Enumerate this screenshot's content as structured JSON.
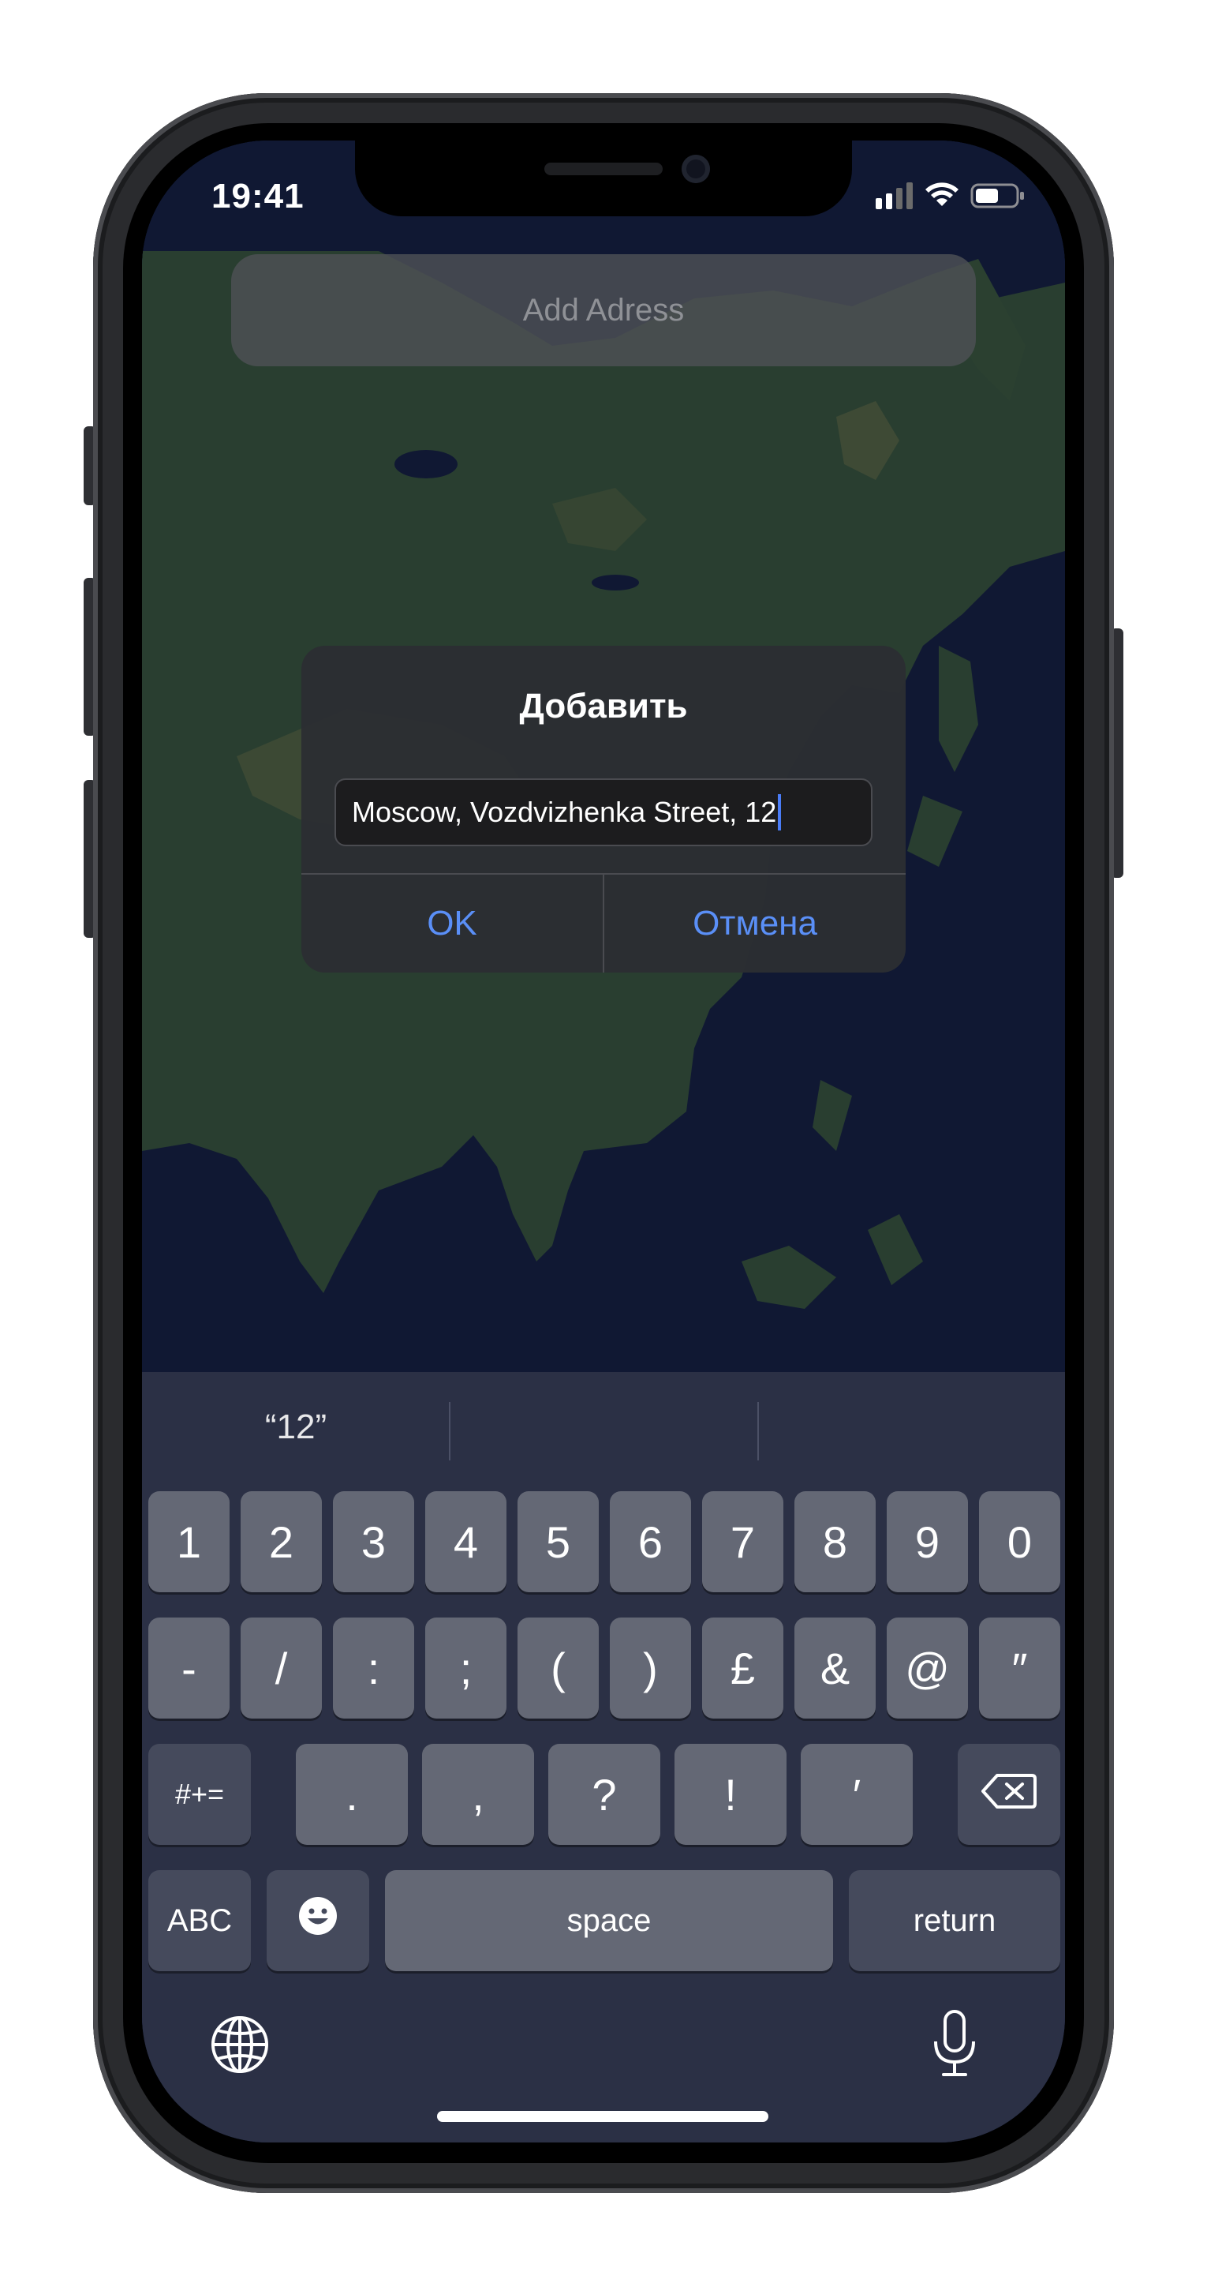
{
  "status_bar": {
    "time": "19:41",
    "icons": [
      "cellular-signal-icon",
      "wifi-icon",
      "battery-icon"
    ]
  },
  "search": {
    "placeholder": "Add Adress"
  },
  "alert": {
    "title": "Добавить",
    "field_value": "Moscow, Vozdvizhenka Street, 12",
    "ok_label": "OK",
    "cancel_label": "Отмена"
  },
  "keyboard": {
    "suggestions": [
      "“12”",
      "",
      ""
    ],
    "row1": [
      "1",
      "2",
      "3",
      "4",
      "5",
      "6",
      "7",
      "8",
      "9",
      "0"
    ],
    "row2": [
      "-",
      "/",
      ":",
      ";",
      "(",
      ")",
      "£",
      "&",
      "@",
      "″"
    ],
    "row3": {
      "shift_label": "#+=",
      "keys": [
        ".",
        ",",
        "?",
        "!",
        "′"
      ],
      "delete_icon": "backspace-icon"
    },
    "row4": {
      "abc_label": "ABC",
      "emoji_icon": "emoji-icon",
      "space_label": "space",
      "return_label": "return"
    },
    "bottom": {
      "globe_icon": "globe-icon",
      "mic_icon": "microphone-icon"
    }
  },
  "colors": {
    "accent": "#5a8ff7",
    "caret": "#4a7cf6",
    "ocean": "#17234a",
    "land": "#3c5a44"
  }
}
